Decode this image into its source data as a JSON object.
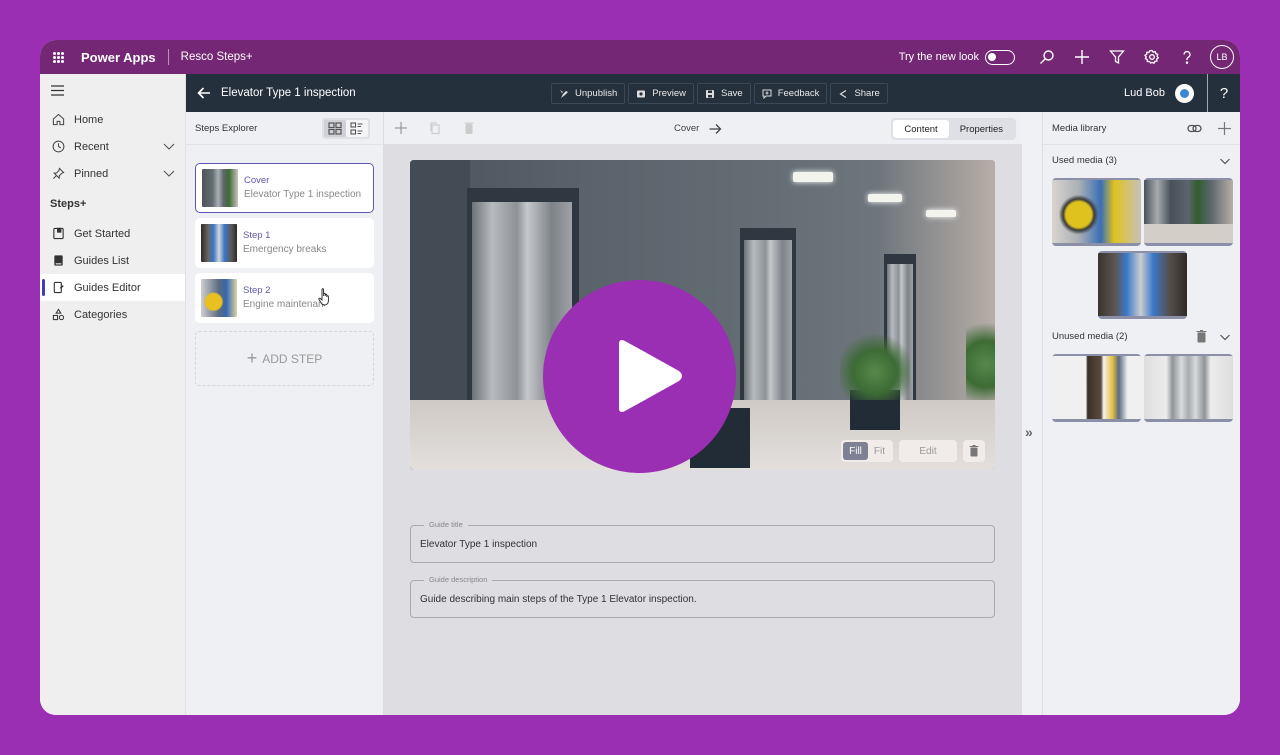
{
  "topbar": {
    "brand": "Power Apps",
    "app_name": "Resco Steps+",
    "try_new_look_label": "Try the new look",
    "try_new_look_on": false,
    "avatar_initials": "LB",
    "icons": [
      "waffle-icon",
      "search-icon",
      "plus-icon",
      "filter-icon",
      "gear-icon",
      "help-icon"
    ]
  },
  "leftnav": {
    "items": [
      {
        "label": "Home",
        "icon": "home-icon"
      },
      {
        "label": "Recent",
        "icon": "clock-icon",
        "expandable": true
      },
      {
        "label": "Pinned",
        "icon": "pin-icon",
        "expandable": true
      }
    ],
    "section_label": "Steps+",
    "section_items": [
      {
        "label": "Get Started",
        "icon": "book-icon"
      },
      {
        "label": "Guides List",
        "icon": "guides-list-icon"
      },
      {
        "label": "Guides Editor",
        "icon": "guides-editor-icon",
        "active": true
      },
      {
        "label": "Categories",
        "icon": "categories-icon"
      }
    ]
  },
  "header": {
    "guide_name": "Elevator Type 1 inspection",
    "buttons": [
      {
        "label": "Unpublish",
        "icon": "unpublish-icon"
      },
      {
        "label": "Preview",
        "icon": "preview-icon"
      },
      {
        "label": "Save",
        "icon": "save-icon"
      },
      {
        "label": "Feedback",
        "icon": "feedback-icon"
      },
      {
        "label": "Share",
        "icon": "share-icon"
      }
    ],
    "user_name": "Lud Bob",
    "help": "?"
  },
  "steps_explorer": {
    "title": "Steps Explorer",
    "steps": [
      {
        "title": "Cover",
        "subtitle": "Elevator Type 1 inspection",
        "selected": true
      },
      {
        "title": "Step 1",
        "subtitle": "Emergency breaks",
        "selected": false
      },
      {
        "title": "Step 2",
        "subtitle": "Engine maintenance",
        "selected": false
      }
    ],
    "add_step_label": "ADD STEP"
  },
  "editor": {
    "crumb": "Cover",
    "tabs": [
      {
        "label": "Content",
        "active": true
      },
      {
        "label": "Properties",
        "active": false
      }
    ],
    "image_controls": {
      "fill_label": "Fill",
      "fit_label": "Fit",
      "mode": "Fill",
      "edit_label": "Edit"
    },
    "fields": [
      {
        "label": "Guide title",
        "value": "Elevator Type 1 inspection"
      },
      {
        "label": "Guide description",
        "value": "Guide describing main steps of the Type 1 Elevator inspection."
      }
    ]
  },
  "media_library": {
    "title": "Media library",
    "used_label": "Used media (3)",
    "unused_label": "Unused media (2)",
    "collapse_glyph": "»"
  },
  "colors": {
    "frame_bg": "#9b2fb4",
    "topbar": "#742774",
    "header": "#25303d",
    "accent": "#5b57b0",
    "play_button": "#9a2fb3"
  }
}
